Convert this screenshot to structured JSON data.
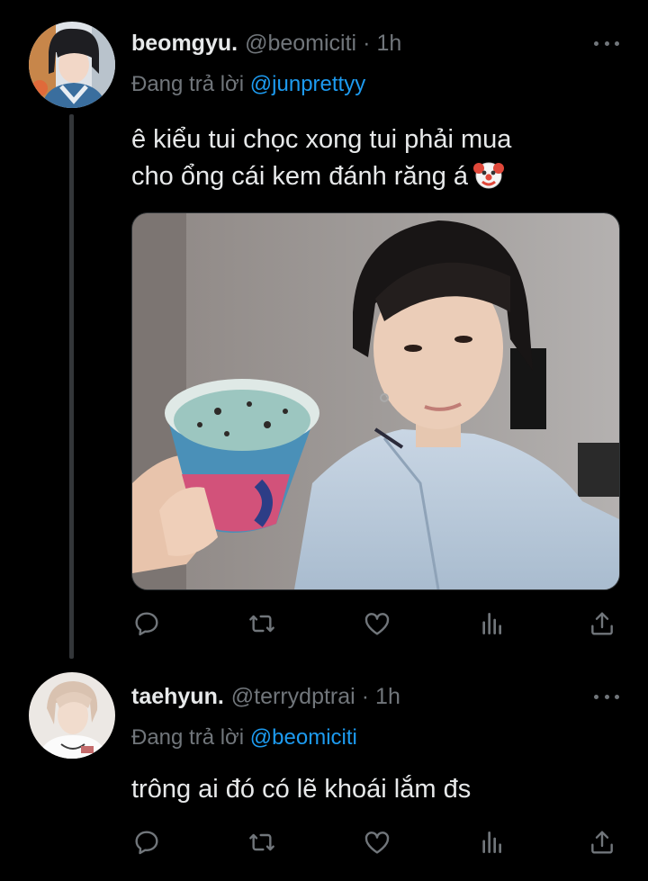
{
  "tweets": [
    {
      "display_name": "beomgyu.",
      "handle": "@beomiciti",
      "separator": "·",
      "time": "1h",
      "reply_prefix": "Đang trả lời",
      "reply_to": "@junprettyy",
      "text_line1": "ê kiểu tui chọc xong tui phải mua",
      "text_line2": "cho ổng cái kem đánh răng á",
      "text_emoji": "clown-face-emoji",
      "has_media": true
    },
    {
      "display_name": "taehyun.",
      "handle": "@terrydptrai",
      "separator": "·",
      "time": "1h",
      "reply_prefix": "Đang trả lời",
      "reply_to": "@beomiciti",
      "text_line1": "trông ai đó có lẽ khoái lắm đs",
      "has_media": false
    }
  ],
  "action_icons": [
    "reply-icon",
    "retweet-icon",
    "like-icon",
    "views-icon",
    "share-icon"
  ],
  "colors": {
    "background": "#000000",
    "primary_text": "#e7e9ea",
    "secondary_text": "#71767b",
    "mention": "#1d9bf0",
    "thread_line": "#333639"
  }
}
